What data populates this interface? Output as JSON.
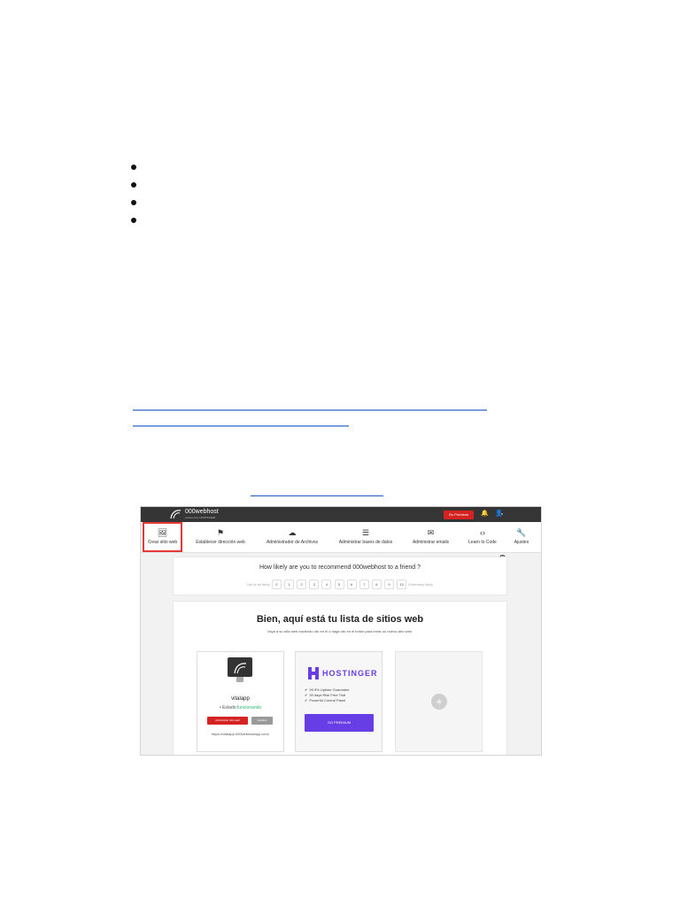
{
  "doc": {
    "bullets": [
      "",
      "",
      "",
      ""
    ]
  },
  "app": {
    "brand": "000webhost",
    "brand_sub": "powered by HOSTINGER",
    "top_go_premium": "Go Premium",
    "user_label": "n",
    "nav": [
      {
        "label": "Crear sitio web",
        "icon": "image-icon",
        "glyph": "🖼"
      },
      {
        "label": "Establecer dirección web",
        "icon": "flag-icon",
        "glyph": "⚑"
      },
      {
        "label": "Administrador de Archivos",
        "icon": "cloud-upload-icon",
        "glyph": "☁"
      },
      {
        "label": "Administrar bases de datos",
        "icon": "database-icon",
        "glyph": "☰"
      },
      {
        "label": "Administrar emails",
        "icon": "mail-icon",
        "glyph": "✉"
      },
      {
        "label": "Learn to Code",
        "icon": "code-icon",
        "glyph": "‹›"
      },
      {
        "label": "Ajustes",
        "icon": "wrench-icon",
        "glyph": "🔧"
      }
    ],
    "survey": {
      "question": "How likely are you to recommend 000webhost to a friend ?",
      "low_label": "Not at all likely",
      "high_label": "Extremely likely",
      "scale": [
        "0",
        "1",
        "2",
        "3",
        "4",
        "5",
        "6",
        "7",
        "8",
        "9",
        "10"
      ]
    },
    "sites": {
      "title": "Bien, aquí está tu lista de sitios web",
      "subtitle": "Vaya a su sitio web haciendo clic en él o haga clic en el botón para crear un nuevo sitio web.",
      "site": {
        "name": "vitalapp",
        "status_prefix": "• Estado:",
        "status_value": "funcionando",
        "admin_button": "Administrar sitio web",
        "details_button": "Detalles",
        "url": "https://vitalapp.000webhostapp.com/"
      },
      "promo": {
        "brand": "HOSTINGER",
        "features": [
          "99.9% Uptime Guarantee",
          "30 days Risk Free Trial",
          "Powerful Control Panel"
        ],
        "button": "GO PREMIUM"
      },
      "add_label": "+"
    }
  },
  "colors": {
    "topbar": "#353535",
    "premium_red": "#d52323",
    "hostinger_purple": "#673de6",
    "status_green": "#2eb872",
    "highlight_red": "#e53935"
  }
}
